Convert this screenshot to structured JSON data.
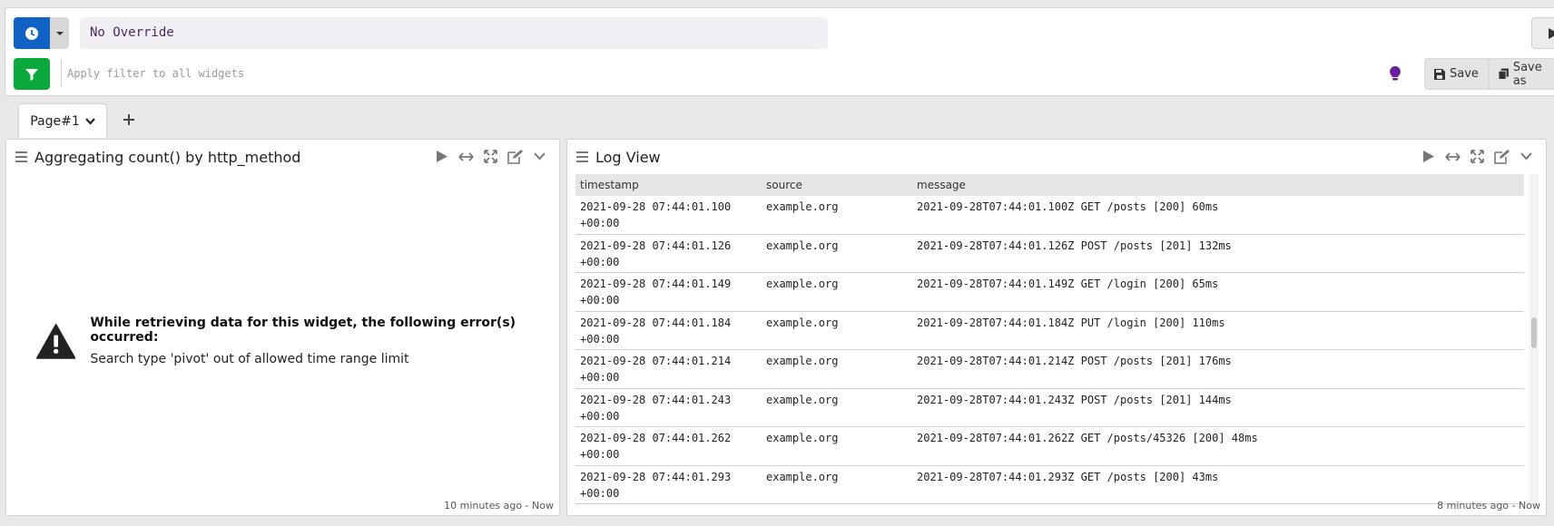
{
  "topbar": {
    "time_override": "No Override",
    "filter_placeholder": "Apply filter to all widgets",
    "save_label": "Save",
    "saveas_label": "Save as"
  },
  "tabs": {
    "page_label": "Page#1"
  },
  "widget_left": {
    "title": "Aggregating count() by http_method",
    "error_heading": "While retrieving data for this widget, the following error(s) occurred:",
    "error_detail": "Search type 'pivot' out of allowed time range limit",
    "footer": "10 minutes ago - Now"
  },
  "widget_right": {
    "title": "Log View",
    "columns": [
      "timestamp",
      "source",
      "message"
    ],
    "rows": [
      {
        "ts1": "2021-09-28 07:44:01.100",
        "ts2": "+00:00",
        "source": "example.org",
        "message": "2021-09-28T07:44:01.100Z GET /posts [200] 60ms"
      },
      {
        "ts1": "2021-09-28 07:44:01.126",
        "ts2": "+00:00",
        "source": "example.org",
        "message": "2021-09-28T07:44:01.126Z POST /posts [201] 132ms"
      },
      {
        "ts1": "2021-09-28 07:44:01.149",
        "ts2": "+00:00",
        "source": "example.org",
        "message": "2021-09-28T07:44:01.149Z GET /login [200] 65ms"
      },
      {
        "ts1": "2021-09-28 07:44:01.184",
        "ts2": "+00:00",
        "source": "example.org",
        "message": "2021-09-28T07:44:01.184Z PUT /login [200] 110ms"
      },
      {
        "ts1": "2021-09-28 07:44:01.214",
        "ts2": "+00:00",
        "source": "example.org",
        "message": "2021-09-28T07:44:01.214Z POST /posts [201] 176ms"
      },
      {
        "ts1": "2021-09-28 07:44:01.243",
        "ts2": "+00:00",
        "source": "example.org",
        "message": "2021-09-28T07:44:01.243Z POST /posts [201] 144ms"
      },
      {
        "ts1": "2021-09-28 07:44:01.262",
        "ts2": "+00:00",
        "source": "example.org",
        "message": "2021-09-28T07:44:01.262Z GET /posts/45326 [200] 48ms"
      },
      {
        "ts1": "2021-09-28 07:44:01.293",
        "ts2": "+00:00",
        "source": "example.org",
        "message": "2021-09-28T07:44:01.293Z GET /posts [200] 43ms"
      }
    ],
    "footer": "8 minutes ago - Now"
  },
  "colors": {
    "time_button": "#1062c4",
    "filter_button": "#0aab3c",
    "bulb": "#6a1fa0"
  },
  "icons": [
    "clock-icon",
    "caret-down-icon",
    "play-icon",
    "filter-icon",
    "bulb-icon",
    "floppy-icon",
    "copy-icon",
    "chevron-down-icon",
    "plus-icon",
    "drag-handle-icon",
    "resize-horizontal-icon",
    "expand-icon",
    "edit-icon",
    "warning-icon"
  ]
}
